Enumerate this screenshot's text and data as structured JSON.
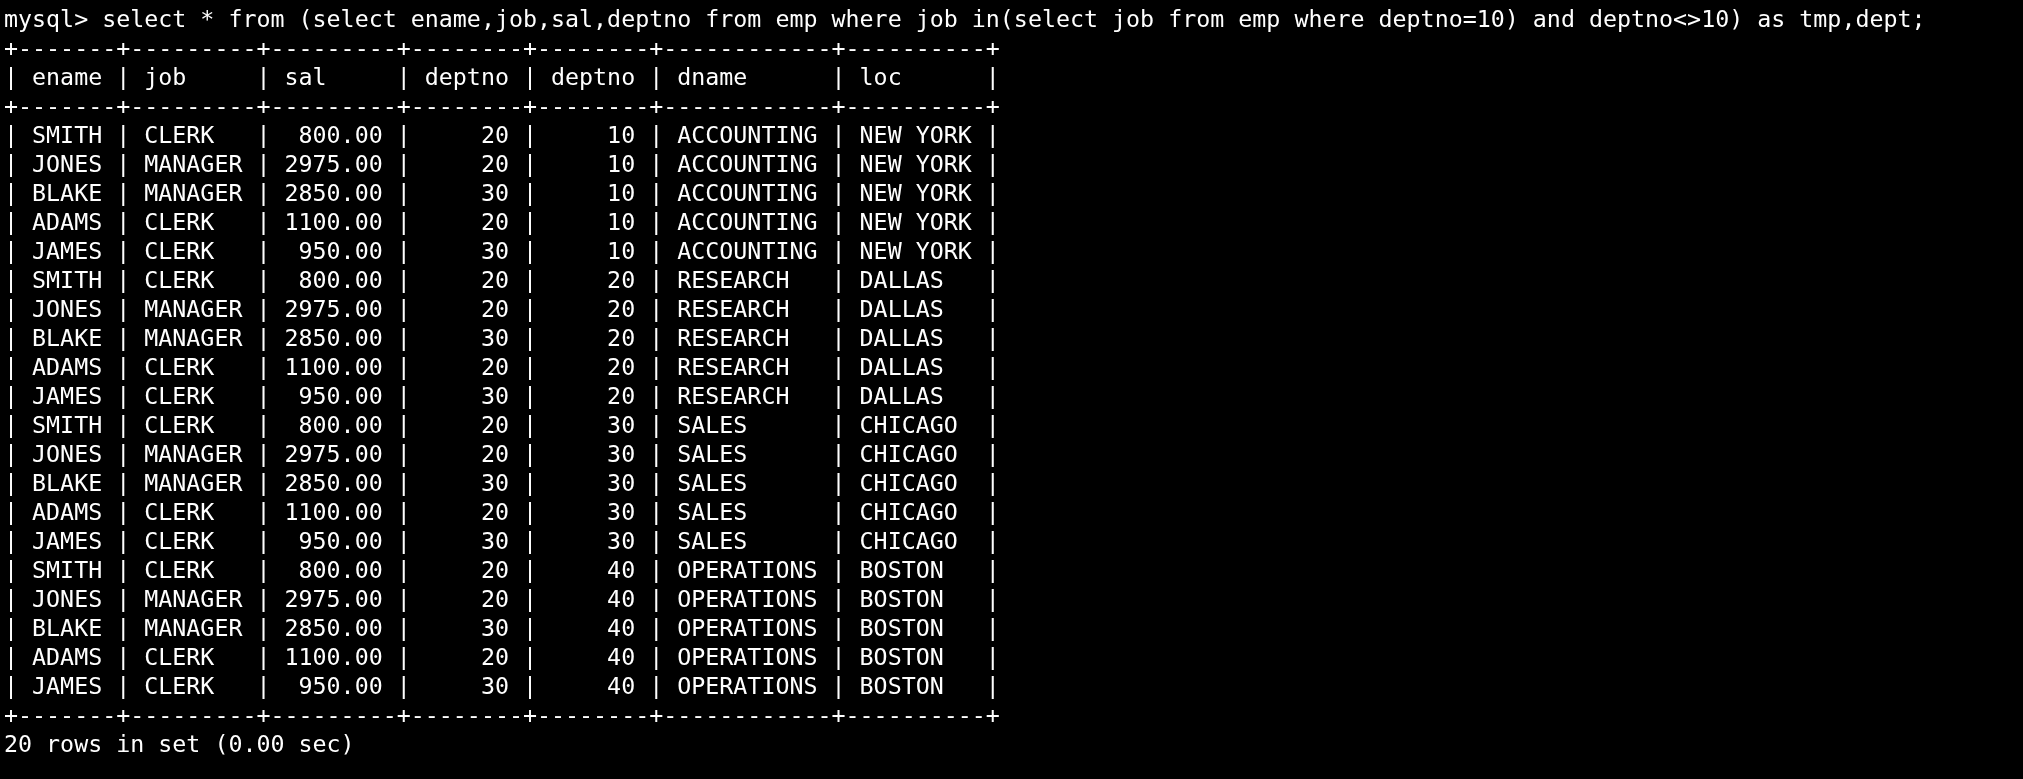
{
  "terminal": {
    "command": "mysql> select * from (select ename,job,sal,deptno from emp where job in(select job from emp where deptno=10) and deptno<>10) as tmp,dept;",
    "output_lines": [
      "+-------+---------+---------+--------+--------+------------+----------+",
      "| ename | job     | sal     | deptno | deptno | dname      | loc      |",
      "+-------+---------+---------+--------+--------+------------+----------+",
      "| SMITH | CLERK   |  800.00 |     20 |     10 | ACCOUNTING | NEW YORK |",
      "| JONES | MANAGER | 2975.00 |     20 |     10 | ACCOUNTING | NEW YORK |",
      "| BLAKE | MANAGER | 2850.00 |     30 |     10 | ACCOUNTING | NEW YORK |",
      "| ADAMS | CLERK   | 1100.00 |     20 |     10 | ACCOUNTING | NEW YORK |",
      "| JAMES | CLERK   |  950.00 |     30 |     10 | ACCOUNTING | NEW YORK |",
      "| SMITH | CLERK   |  800.00 |     20 |     20 | RESEARCH   | DALLAS   |",
      "| JONES | MANAGER | 2975.00 |     20 |     20 | RESEARCH   | DALLAS   |",
      "| BLAKE | MANAGER | 2850.00 |     30 |     20 | RESEARCH   | DALLAS   |",
      "| ADAMS | CLERK   | 1100.00 |     20 |     20 | RESEARCH   | DALLAS   |",
      "| JAMES | CLERK   |  950.00 |     30 |     20 | RESEARCH   | DALLAS   |",
      "| SMITH | CLERK   |  800.00 |     20 |     30 | SALES      | CHICAGO  |",
      "| JONES | MANAGER | 2975.00 |     20 |     30 | SALES      | CHICAGO  |",
      "| BLAKE | MANAGER | 2850.00 |     30 |     30 | SALES      | CHICAGO  |",
      "| ADAMS | CLERK   | 1100.00 |     20 |     30 | SALES      | CHICAGO  |",
      "| JAMES | CLERK   |  950.00 |     30 |     30 | SALES      | CHICAGO  |",
      "| SMITH | CLERK   |  800.00 |     20 |     40 | OPERATIONS | BOSTON   |",
      "| JONES | MANAGER | 2975.00 |     20 |     40 | OPERATIONS | BOSTON   |",
      "| BLAKE | MANAGER | 2850.00 |     30 |     40 | OPERATIONS | BOSTON   |",
      "| ADAMS | CLERK   | 1100.00 |     20 |     40 | OPERATIONS | BOSTON   |",
      "| JAMES | CLERK   |  950.00 |     30 |     40 | OPERATIONS | BOSTON   |",
      "+-------+---------+---------+--------+--------+------------+----------+"
    ],
    "status": "20 rows in set (0.00 sec)"
  }
}
